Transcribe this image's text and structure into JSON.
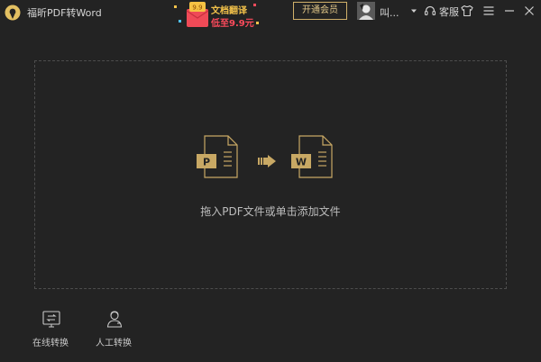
{
  "app": {
    "title": "福昕PDF转Word"
  },
  "promo": {
    "badge": "9.9",
    "line1": "文档翻译",
    "line2": "低至9.9元"
  },
  "header": {
    "vip_label": "开通会员",
    "username": "叫...",
    "service_label": "客服"
  },
  "dropzone": {
    "hint": "拖入PDF文件或单击添加文件",
    "source_letter": "P",
    "target_letter": "W"
  },
  "tools": [
    {
      "label": "在线转换",
      "icon": "online-convert-icon"
    },
    {
      "label": "人工转换",
      "icon": "manual-convert-icon"
    }
  ],
  "colors": {
    "background": "#232323",
    "gold": "#d0b06a",
    "promo_yellow": "#f3c24a",
    "promo_red": "#ff4b5c"
  }
}
